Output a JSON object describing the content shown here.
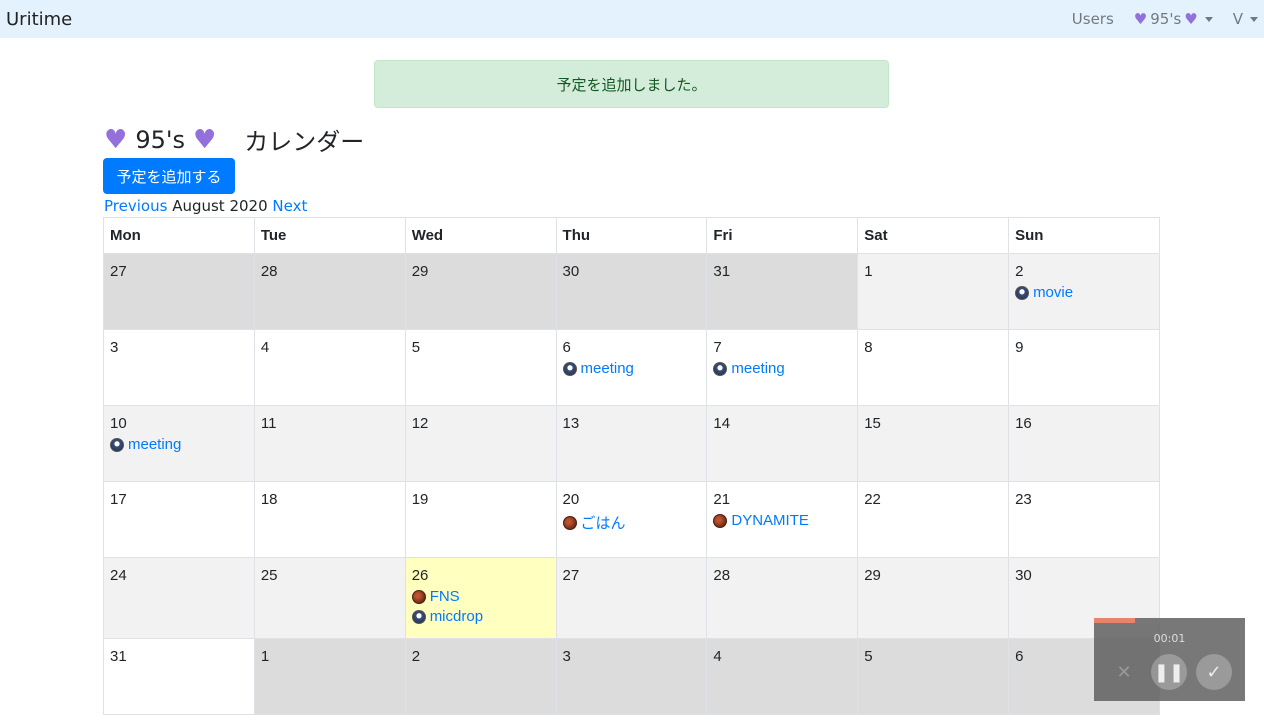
{
  "navbar": {
    "brand": "Uritime",
    "users": "Users",
    "group_name": "95's",
    "user_menu": "V"
  },
  "alert": {
    "message": "予定を追加しました。"
  },
  "header": {
    "group_name": "95's",
    "calendar_label": "カレンダー"
  },
  "add_button": "予定を追加する",
  "month_nav": {
    "previous": "Previous",
    "month": "August 2020",
    "next": "Next"
  },
  "calendar": {
    "weekdays": [
      "Mon",
      "Tue",
      "Wed",
      "Thu",
      "Fri",
      "Sat",
      "Sun"
    ],
    "weeks": [
      [
        {
          "day": "27",
          "other": true
        },
        {
          "day": "28",
          "other": true
        },
        {
          "day": "29",
          "other": true
        },
        {
          "day": "30",
          "other": true
        },
        {
          "day": "31",
          "other": true
        },
        {
          "day": "1"
        },
        {
          "day": "2",
          "events": [
            {
              "title": "movie",
              "avatar": "blue"
            }
          ]
        }
      ],
      [
        {
          "day": "3"
        },
        {
          "day": "4"
        },
        {
          "day": "5"
        },
        {
          "day": "6",
          "events": [
            {
              "title": "meeting",
              "avatar": "blue"
            }
          ]
        },
        {
          "day": "7",
          "events": [
            {
              "title": "meeting",
              "avatar": "blue"
            }
          ]
        },
        {
          "day": "8"
        },
        {
          "day": "9"
        }
      ],
      [
        {
          "day": "10",
          "events": [
            {
              "title": "meeting",
              "avatar": "blue"
            }
          ]
        },
        {
          "day": "11"
        },
        {
          "day": "12"
        },
        {
          "day": "13"
        },
        {
          "day": "14"
        },
        {
          "day": "15"
        },
        {
          "day": "16"
        }
      ],
      [
        {
          "day": "17"
        },
        {
          "day": "18"
        },
        {
          "day": "19"
        },
        {
          "day": "20",
          "events": [
            {
              "title": "ごはん",
              "avatar": "brown"
            }
          ]
        },
        {
          "day": "21",
          "events": [
            {
              "title": "DYNAMITE",
              "avatar": "brown"
            }
          ]
        },
        {
          "day": "22"
        },
        {
          "day": "23"
        }
      ],
      [
        {
          "day": "24"
        },
        {
          "day": "25"
        },
        {
          "day": "26",
          "today": true,
          "events": [
            {
              "title": "FNS",
              "avatar": "brown"
            },
            {
              "title": "micdrop",
              "avatar": "blue"
            }
          ]
        },
        {
          "day": "27"
        },
        {
          "day": "28"
        },
        {
          "day": "29"
        },
        {
          "day": "30"
        }
      ],
      [
        {
          "day": "31"
        },
        {
          "day": "1",
          "other": true
        },
        {
          "day": "2",
          "other": true
        },
        {
          "day": "3",
          "other": true
        },
        {
          "day": "4",
          "other": true
        },
        {
          "day": "5",
          "other": true
        },
        {
          "day": "6",
          "other": true
        }
      ]
    ]
  },
  "recorder": {
    "time": "00:01",
    "progress": 0.27
  },
  "colors": {
    "navbar_bg": "#e3f2fd",
    "primary": "#007bff",
    "alert_bg": "#d4edda",
    "today_bg": "#ffffc0",
    "heart": "#9370db"
  }
}
